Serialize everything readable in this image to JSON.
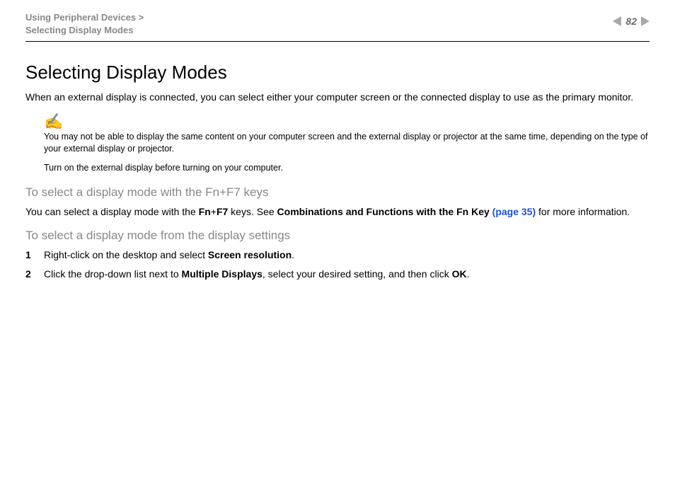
{
  "breadcrumb": {
    "line1": "Using Peripheral Devices >",
    "line2": "Selecting Display Modes"
  },
  "page_number": "82",
  "title": "Selecting Display Modes",
  "intro": "When an external display is connected, you can select either your computer screen or the connected display to use as the primary monitor.",
  "note": {
    "p1": "You may not be able to display the same content on your computer screen and the external display or projector at the same time, depending on the type of your external display or projector.",
    "p2": "Turn on the external display before turning on your computer."
  },
  "section1_heading": "To select a display mode with the Fn+F7 keys",
  "section1_body_pre": "You can select a display mode with the ",
  "section1_fn": "Fn",
  "section1_plus": "+",
  "section1_f7": "F7",
  "section1_body_mid": " keys. See ",
  "section1_link_strong": "Combinations and Functions with the Fn Key ",
  "section1_link_page": "(page 35)",
  "section1_body_post": " for more information.",
  "section2_heading": "To select a display mode from the display settings",
  "steps": {
    "s1_num": "1",
    "s1_pre": "Right-click on the desktop and select ",
    "s1_bold": "Screen resolution",
    "s1_post": ".",
    "s2_num": "2",
    "s2_pre": "Click the drop-down list next to ",
    "s2_bold1": "Multiple Displays",
    "s2_mid": ", select your desired setting, and then click ",
    "s2_bold2": "OK",
    "s2_post": "."
  }
}
